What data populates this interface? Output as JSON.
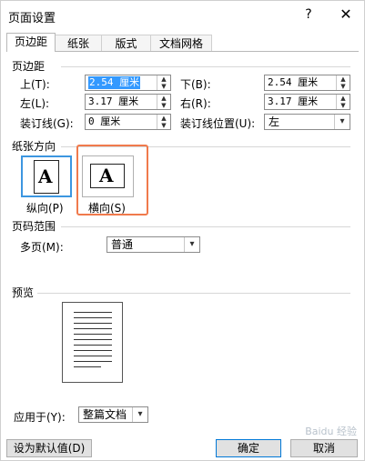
{
  "window": {
    "title": "页面设置",
    "help_label": "?",
    "close_label": "✕"
  },
  "tabs": [
    {
      "label": "页边距",
      "active": true
    },
    {
      "label": "纸张",
      "active": false
    },
    {
      "label": "版式",
      "active": false
    },
    {
      "label": "文档网格",
      "active": false
    }
  ],
  "margins": {
    "section_label": "页边距",
    "top": {
      "label": "上(T):",
      "value": "2.54 厘米"
    },
    "bottom": {
      "label": "下(B):",
      "value": "2.54 厘米"
    },
    "left": {
      "label": "左(L):",
      "value": "3.17 厘米"
    },
    "right": {
      "label": "右(R):",
      "value": "3.17 厘米"
    },
    "gutter": {
      "label": "装订线(G):",
      "value": "0 厘米"
    },
    "gutter_pos": {
      "label": "装订线位置(U):",
      "value": "左"
    }
  },
  "orientation": {
    "section_label": "纸张方向",
    "portrait": {
      "label": "纵向(P)",
      "glyph": "A"
    },
    "landscape": {
      "label": "横向(S)",
      "glyph": "A"
    },
    "highlight_color": "#f07a4c"
  },
  "pages": {
    "section_label": "页码范围",
    "multiple_label": "多页(M):",
    "multiple_value": "普通"
  },
  "preview": {
    "section_label": "预览",
    "apply_label": "应用于(Y):",
    "apply_value": "整篇文档"
  },
  "buttons": {
    "default_label": "设为默认值(D)",
    "ok_label": "确定",
    "cancel_label": "取消"
  },
  "watermark": "Baidu 经验"
}
